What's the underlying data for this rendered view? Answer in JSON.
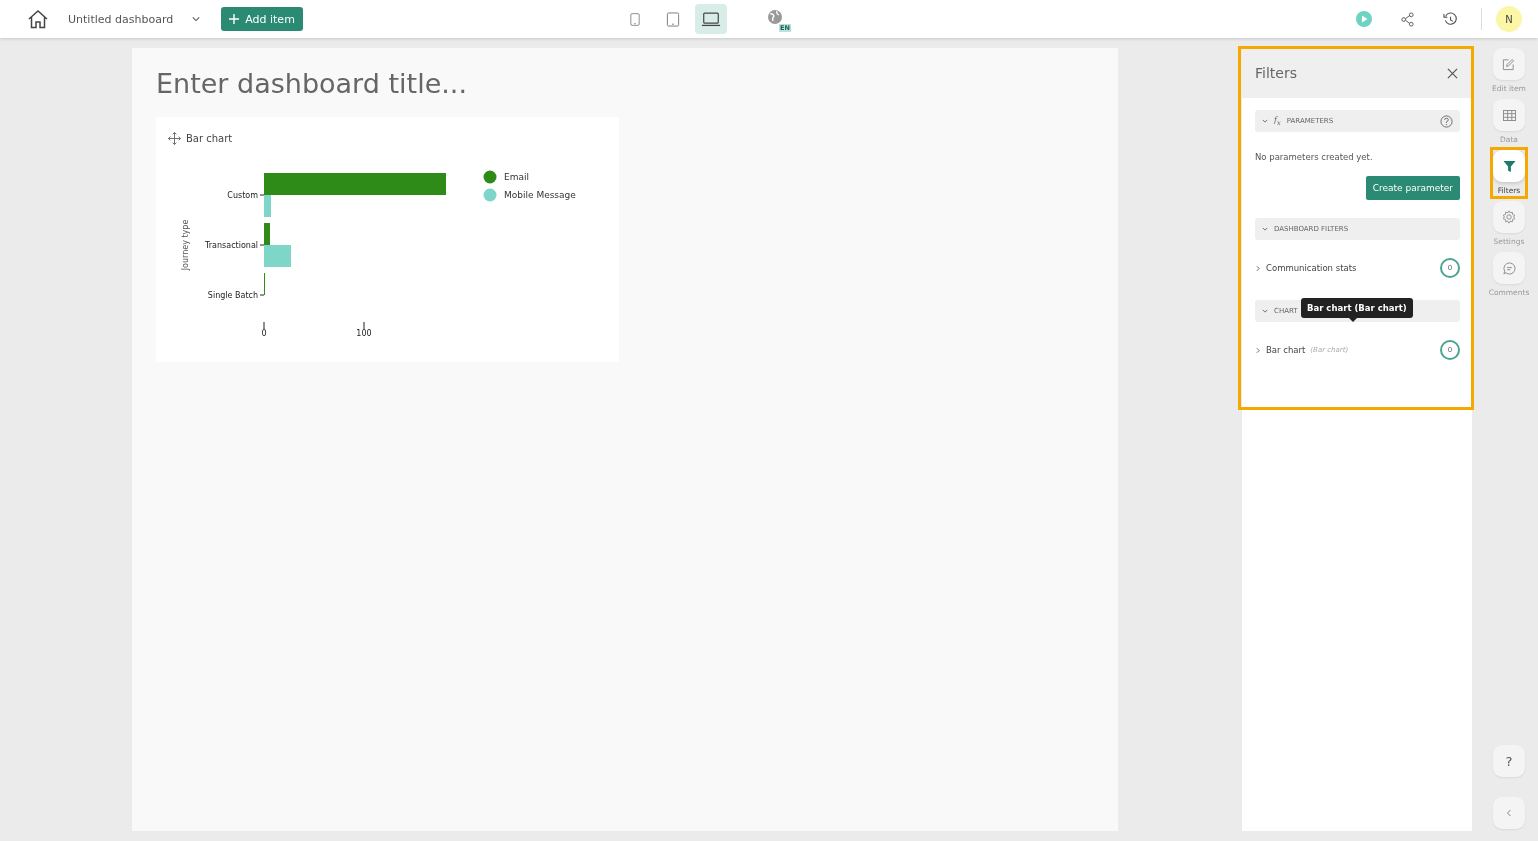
{
  "top_bar": {
    "dashboard_name": "Untitled dashboard",
    "add_button": "Add item",
    "view_modes": [
      {
        "kind": "phone",
        "selected": false
      },
      {
        "kind": "tablet",
        "selected": false
      },
      {
        "kind": "laptop",
        "selected": true
      }
    ],
    "language_badge": "EN",
    "avatar": "N"
  },
  "dashboard": {
    "title_placeholder": "Enter dashboard title...",
    "widgets": [
      {
        "title": "Bar chart",
        "chart_data": {
          "type": "bar",
          "orientation": "horizontal",
          "ylabel": "Journey type",
          "categories": [
            "Custom",
            "Transactional",
            "Single Batch"
          ],
          "series": [
            {
              "name": "Email",
              "color": "#2e8b17",
              "values": [
                182,
                6,
                1
              ]
            },
            {
              "name": "Mobile Message",
              "color": "#7dd6c8",
              "values": [
                7,
                27,
                0
              ]
            }
          ],
          "xticks": [
            0,
            100
          ],
          "xlim": [
            0,
            182
          ],
          "legend": true
        }
      }
    ]
  },
  "filters_panel": {
    "title": "Filters",
    "highlighted": true,
    "sections": [
      {
        "kind": "parameters",
        "icon": "f$_{x}$",
        "heading": "PARAMETERS",
        "expanded": true,
        "empty_text": "No parameters created yet.",
        "button": "Create parameter"
      },
      {
        "kind": "dashboard",
        "heading": "DASHBOARD FILTERS",
        "expanded": true,
        "items": [
          {
            "label": "Communication stats",
            "count": "0"
          }
        ]
      },
      {
        "kind": "chart",
        "heading": "CHART",
        "expanded": true,
        "items": [
          {
            "label": "Bar chart",
            "sublabel": "(Bar chart)",
            "count": "0"
          }
        ]
      }
    ],
    "tooltip": "Bar chart (Bar chart)"
  },
  "right_rail": {
    "items": [
      {
        "kind": "edit",
        "label": "Edit item",
        "selected": false,
        "highlighted": false
      },
      {
        "kind": "data",
        "label": "Data",
        "selected": false,
        "highlighted": false
      },
      {
        "kind": "filters",
        "label": "Filters",
        "selected": true,
        "highlighted": true
      },
      {
        "kind": "settings",
        "label": "Settings",
        "selected": false,
        "highlighted": false
      },
      {
        "kind": "comments",
        "label": "Comments",
        "selected": false,
        "highlighted": false
      }
    ],
    "help_button": "?"
  }
}
